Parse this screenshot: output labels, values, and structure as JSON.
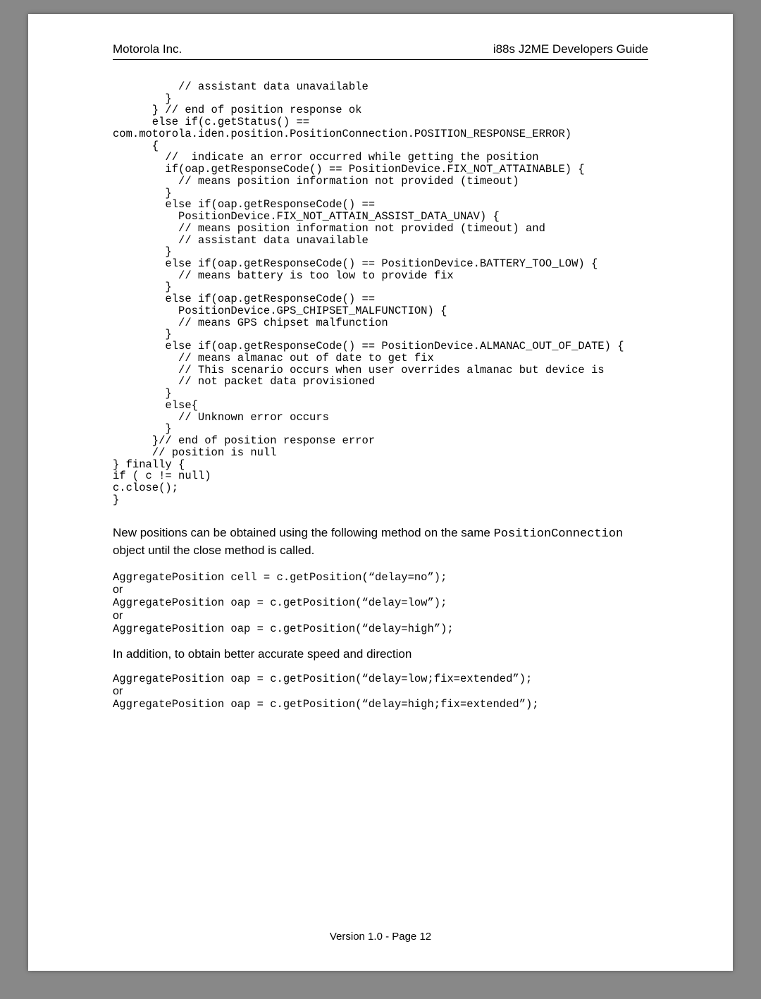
{
  "header": {
    "left": "Motorola Inc.",
    "right": "i88s J2ME Developers  Guide"
  },
  "code_block_1": "          // assistant data unavailable\n        }\n      } // end of position response ok\n      else if(c.getStatus() ==\ncom.motorola.iden.position.PositionConnection.POSITION_RESPONSE_ERROR)\n      {\n        //  indicate an error occurred while getting the position\n        if(oap.getResponseCode() == PositionDevice.FIX_NOT_ATTAINABLE) {\n          // means position information not provided (timeout)\n        }\n        else if(oap.getResponseCode() ==\n          PositionDevice.FIX_NOT_ATTAIN_ASSIST_DATA_UNAV) {\n          // means position information not provided (timeout) and\n          // assistant data unavailable\n        }\n        else if(oap.getResponseCode() == PositionDevice.BATTERY_TOO_LOW) {\n          // means battery is too low to provide fix\n        }\n        else if(oap.getResponseCode() ==\n          PositionDevice.GPS_CHIPSET_MALFUNCTION) {\n          // means GPS chipset malfunction\n        }\n        else if(oap.getResponseCode() == PositionDevice.ALMANAC_OUT_OF_DATE) {\n          // means almanac out of date to get fix\n          // This scenario occurs when user overrides almanac but device is\n          // not packet data provisioned\n        }\n        else{\n          // Unknown error occurs\n        }\n      }// end of position response error\n      // position is null\n} finally {\nif ( c != null)\nc.close();\n}",
  "paragraph_1_a": "New positions can be obtained using the following method on the same ",
  "paragraph_1_code": "PositionConnection",
  "paragraph_1_b": " object until the close method is called.",
  "snippet2_line1": "AggregatePosition cell = c.getPosition(“delay=no”);",
  "snippet2_line2": "AggregatePosition oap = c.getPosition(“delay=low”);",
  "snippet2_line3": "AggregatePosition oap = c.getPosition(“delay=high”);",
  "or_label": "or",
  "paragraph_2": "In addition, to obtain better accurate speed and direction",
  "snippet3_line1": "AggregatePosition oap = c.getPosition(“delay=low;fix=extended”);",
  "snippet3_line2": "AggregatePosition oap = c.getPosition(“delay=high;fix=extended”);",
  "footer": "Version 1.0 - Page 12"
}
